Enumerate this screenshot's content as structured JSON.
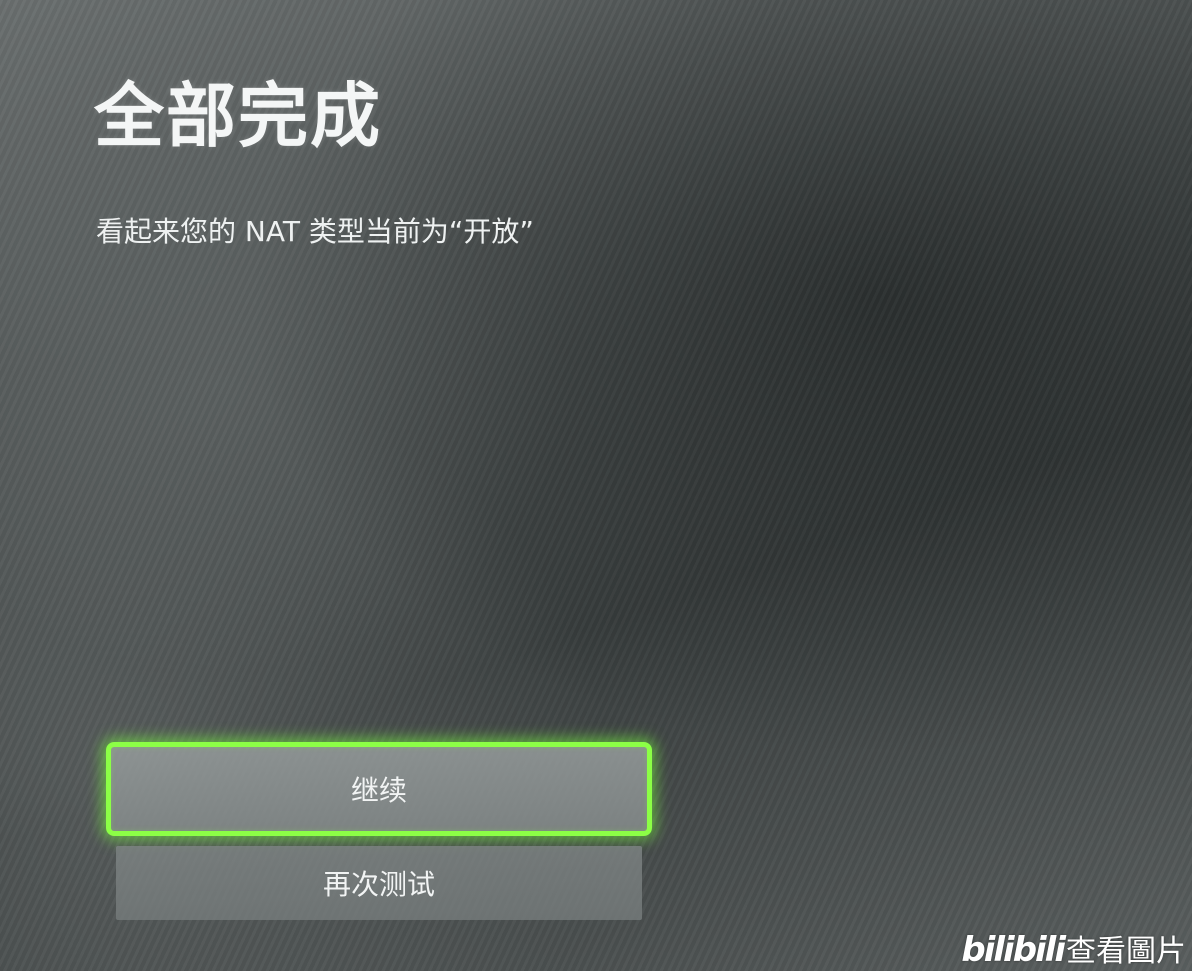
{
  "screen": {
    "title": "全部完成",
    "message": "看起来您的 NAT 类型当前为“开放”"
  },
  "buttons": {
    "continue_label": "继续",
    "retest_label": "再次测试"
  },
  "watermark": {
    "logo": "bilibili",
    "text": "查看圖片"
  },
  "colors": {
    "focus_highlight": "#8cff46",
    "background": "#4e5353",
    "text": "#ffffff"
  }
}
